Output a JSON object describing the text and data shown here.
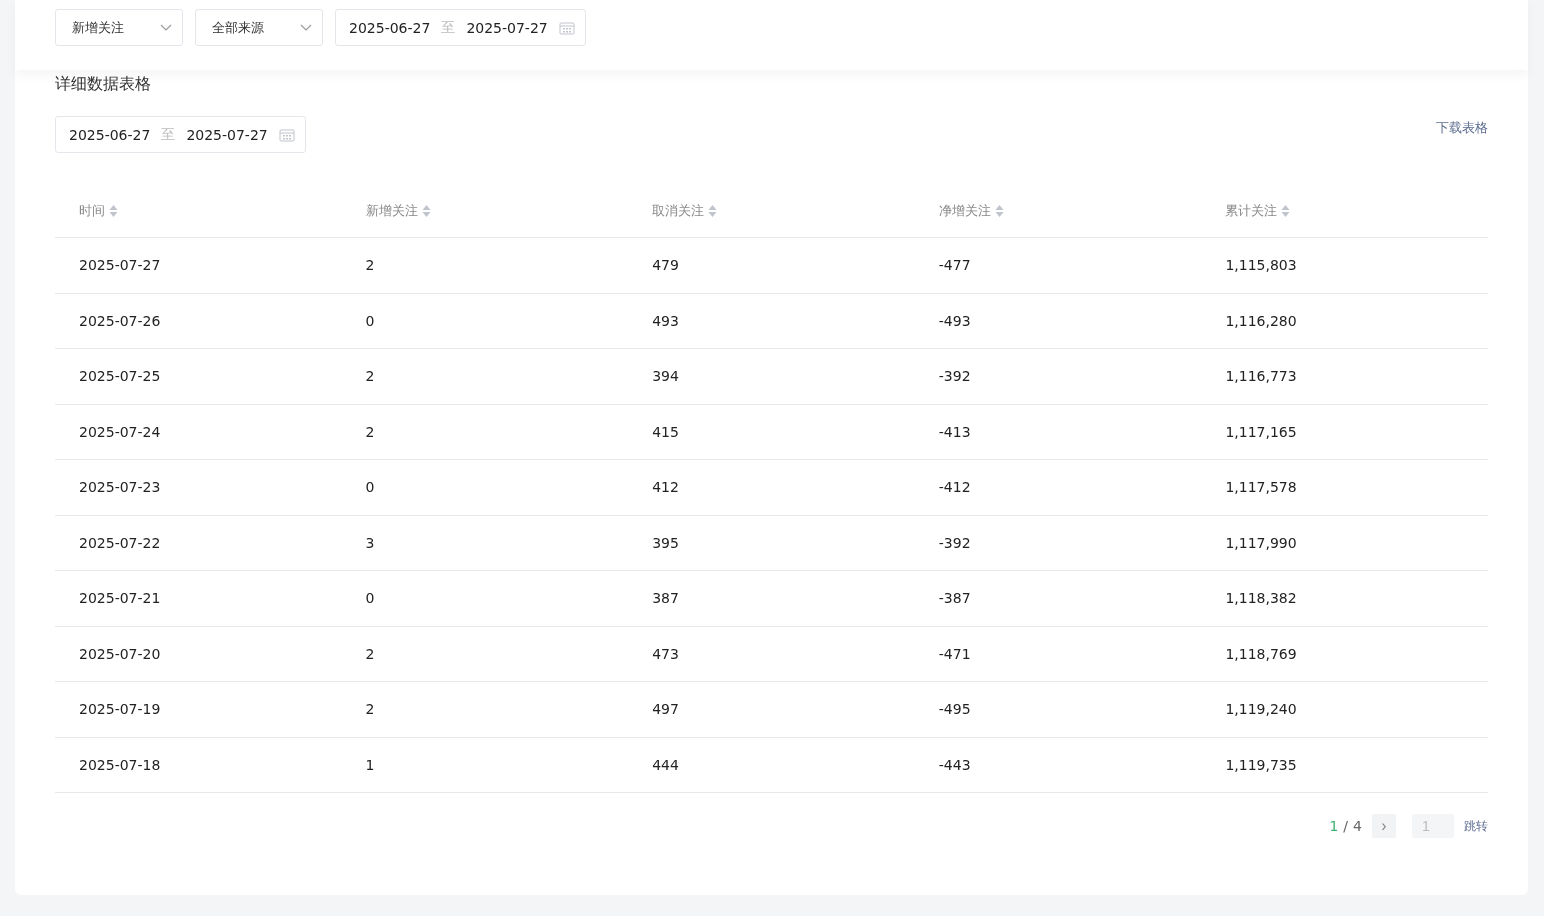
{
  "filters": {
    "metric_select": {
      "value": "新增关注"
    },
    "source_select": {
      "value": "全部来源"
    },
    "date_range": {
      "start": "2025-06-27",
      "separator": "至",
      "end": "2025-07-27"
    }
  },
  "table_section": {
    "title": "详细数据表格",
    "date_range": {
      "start": "2025-06-27",
      "separator": "至",
      "end": "2025-07-27"
    },
    "download_link": "下载表格",
    "columns": [
      "时间",
      "新增关注",
      "取消关注",
      "净增关注",
      "累计关注"
    ],
    "rows": [
      [
        "2025-07-27",
        "2",
        "479",
        "-477",
        "1,115,803"
      ],
      [
        "2025-07-26",
        "0",
        "493",
        "-493",
        "1,116,280"
      ],
      [
        "2025-07-25",
        "2",
        "394",
        "-392",
        "1,116,773"
      ],
      [
        "2025-07-24",
        "2",
        "415",
        "-413",
        "1,117,165"
      ],
      [
        "2025-07-23",
        "0",
        "412",
        "-412",
        "1,117,578"
      ],
      [
        "2025-07-22",
        "3",
        "395",
        "-392",
        "1,117,990"
      ],
      [
        "2025-07-21",
        "0",
        "387",
        "-387",
        "1,118,382"
      ],
      [
        "2025-07-20",
        "2",
        "473",
        "-471",
        "1,118,769"
      ],
      [
        "2025-07-19",
        "2",
        "497",
        "-495",
        "1,119,240"
      ],
      [
        "2025-07-18",
        "1",
        "444",
        "-443",
        "1,119,735"
      ]
    ],
    "pagination": {
      "current": "1",
      "separator": "/",
      "total": "4",
      "next": "›",
      "page_input": {
        "placeholder": "1"
      },
      "jump_button": "跳转"
    }
  }
}
